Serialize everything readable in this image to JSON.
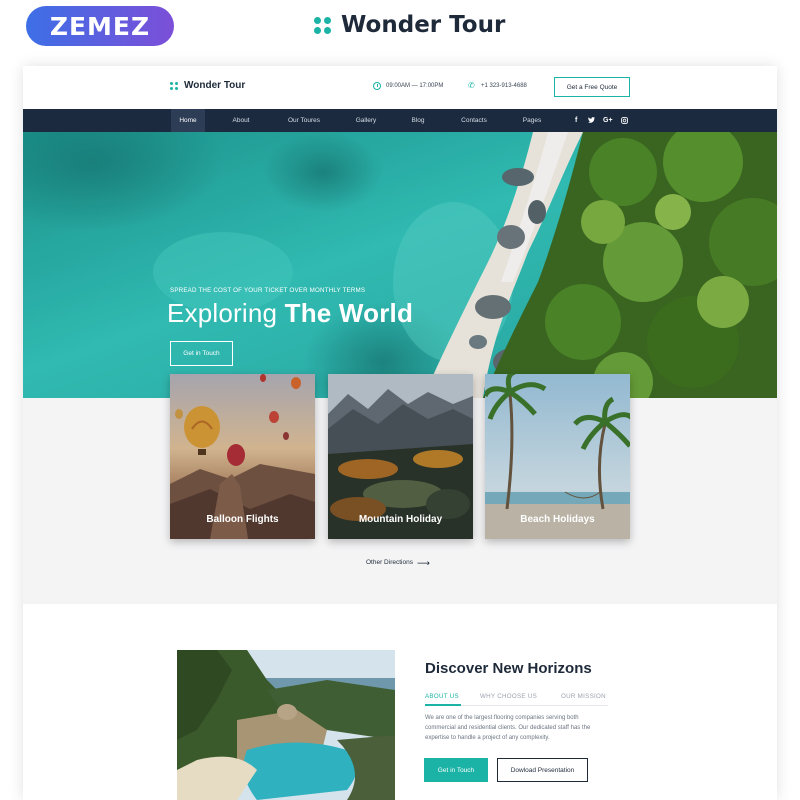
{
  "banner": {
    "zemez_logo": "ZEMEZ",
    "brand_name": "Wonder Tour"
  },
  "site": {
    "brand_name": "Wonder Tour",
    "hours": "09:00AM — 17:00PM",
    "phone": "+1 323-913-4688",
    "quote_button": "Get a Free Quote",
    "accent_color": "#1ab3a6",
    "nav_color": "#1b2a3f"
  },
  "nav": {
    "items": [
      "Home",
      "About",
      "Our Toures",
      "Gallery",
      "Blog",
      "Contacts",
      "Pages"
    ],
    "active": "Home",
    "social": [
      "f",
      "t",
      "G+",
      "ig"
    ]
  },
  "hero": {
    "kicker": "Spread the cost of your ticket over monthly terms",
    "title_light": "Exploring",
    "title_bold": "The World",
    "button": "Get in Touch"
  },
  "cards": [
    {
      "label": "Balloon Flights"
    },
    {
      "label": "Mountain Holiday"
    },
    {
      "label": "Beach Holidays"
    }
  ],
  "other_directions": "Other Directions",
  "about": {
    "title": "Discover New Horizons",
    "tabs": [
      "ABOUT US",
      "WHY CHOOSE US",
      "OUR MISSION"
    ],
    "active_tab": "ABOUT US",
    "text": "We are one of the largest flooring companies serving both commercial and residential clients. Our dedicated staff has the expertise to handle a project of any complexity.",
    "primary_button": "Get in Touch",
    "secondary_button": "Dowload Presentation"
  }
}
